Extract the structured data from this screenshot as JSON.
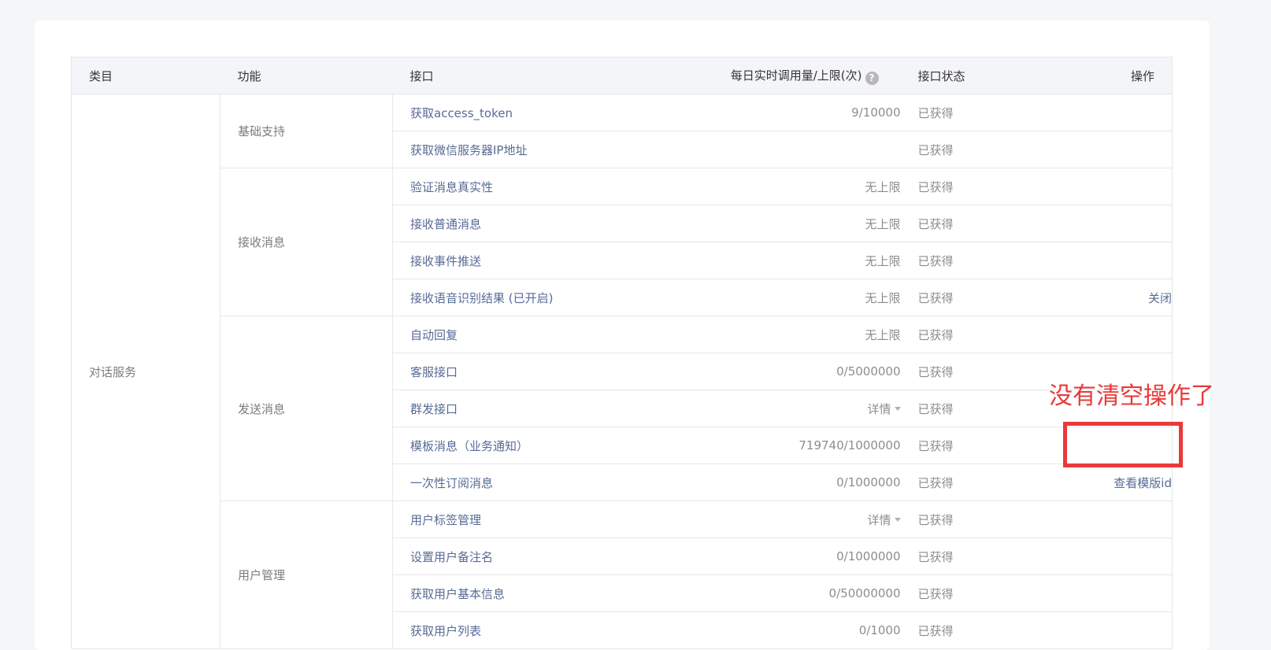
{
  "headers": {
    "category": "类目",
    "function": "功能",
    "interface": "接口",
    "limit": "每日实时调用量/上限(次)",
    "status": "接口状态",
    "operation": "操作"
  },
  "icons": {
    "help": "question-circle-icon",
    "dropdown": "caret-down-icon"
  },
  "category": "对话服务",
  "groups": [
    {
      "label": "基础支持"
    },
    {
      "label": "接收消息"
    },
    {
      "label": "发送消息"
    },
    {
      "label": "用户管理"
    }
  ],
  "rows": [
    {
      "interface": "获取access_token",
      "limit": "9/10000",
      "status": "已获得",
      "op": ""
    },
    {
      "interface": "获取微信服务器IP地址",
      "limit": "",
      "status": "已获得",
      "op": ""
    },
    {
      "interface": "验证消息真实性",
      "limit": "无上限",
      "status": "已获得",
      "op": ""
    },
    {
      "interface": "接收普通消息",
      "limit": "无上限",
      "status": "已获得",
      "op": ""
    },
    {
      "interface": "接收事件推送",
      "limit": "无上限",
      "status": "已获得",
      "op": ""
    },
    {
      "interface": "接收语音识别结果 (已开启)",
      "limit": "无上限",
      "status": "已获得",
      "op": "关闭"
    },
    {
      "interface": "自动回复",
      "limit": "无上限",
      "status": "已获得",
      "op": ""
    },
    {
      "interface": "客服接口",
      "limit": "0/5000000",
      "status": "已获得",
      "op": ""
    },
    {
      "interface": "群发接口",
      "limit": "详情",
      "status": "已获得",
      "op": ""
    },
    {
      "interface": "模板消息（业务通知）",
      "limit": "719740/1000000",
      "status": "已获得",
      "op": ""
    },
    {
      "interface": "一次性订阅消息",
      "limit": "0/1000000",
      "status": "已获得",
      "op": "查看模版id"
    },
    {
      "interface": "用户标签管理",
      "limit": "详情",
      "status": "已获得",
      "op": ""
    },
    {
      "interface": "设置用户备注名",
      "limit": "0/1000000",
      "status": "已获得",
      "op": ""
    },
    {
      "interface": "获取用户基本信息",
      "limit": "0/50000000",
      "status": "已获得",
      "op": ""
    },
    {
      "interface": "获取用户列表",
      "limit": "0/1000",
      "status": "已获得",
      "op": ""
    }
  ],
  "annotation": {
    "text": "没有清空操作了",
    "color": "#e83a3a"
  }
}
